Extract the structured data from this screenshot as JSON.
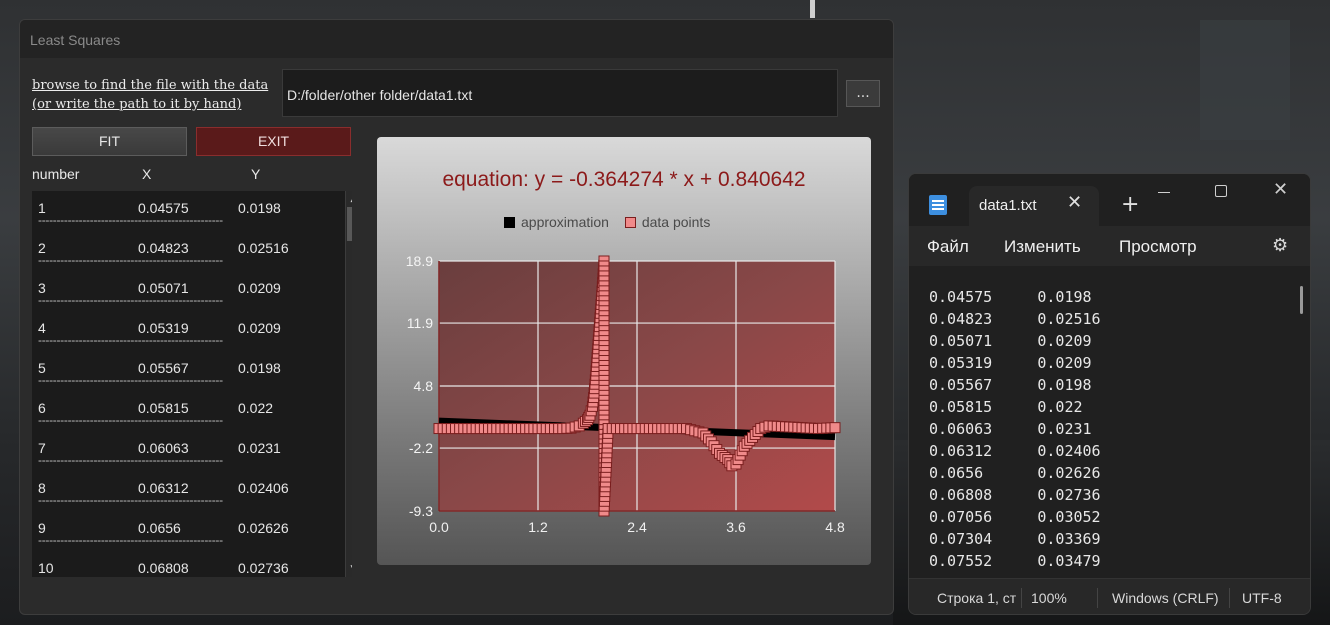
{
  "window": {
    "title": "Least Squares"
  },
  "browse": {
    "label_line1": "browse to find the file with the data",
    "label_line2": "(or write the path to it by hand)",
    "path_value": "D:/folder/other folder/data1.txt",
    "browse_button": "..."
  },
  "buttons": {
    "fit": "FIT",
    "exit": "EXIT"
  },
  "table": {
    "headers": [
      "number",
      "X",
      "Y"
    ],
    "separator": "--------------------------------------------------",
    "rows": [
      [
        "1",
        "0.04575",
        "0.0198"
      ],
      [
        "2",
        "0.04823",
        "0.02516"
      ],
      [
        "3",
        "0.05071",
        "0.0209"
      ],
      [
        "4",
        "0.05319",
        "0.0209"
      ],
      [
        "5",
        "0.05567",
        "0.0198"
      ],
      [
        "6",
        "0.05815",
        "0.022"
      ],
      [
        "7",
        "0.06063",
        "0.0231"
      ],
      [
        "8",
        "0.06312",
        "0.02406"
      ],
      [
        "9",
        "0.0656",
        "0.02626"
      ],
      [
        "10",
        "0.06808",
        "0.02736"
      ]
    ]
  },
  "chart_data": {
    "type": "scatter",
    "title": "equation: y = -0.364274 * x + 0.840642",
    "legend": [
      "approximation",
      "data points"
    ],
    "legend_position": "top",
    "xlim": [
      0.0,
      4.8
    ],
    "ylim": [
      -9.3,
      18.9
    ],
    "xticks": [
      "0.0",
      "1.2",
      "2.4",
      "3.6",
      "4.8"
    ],
    "yticks": [
      "18.9",
      "11.9",
      "4.8",
      "-2.2",
      "-9.3"
    ],
    "grid": true,
    "approximation": {
      "slope": -0.364274,
      "intercept": 0.840642
    },
    "series": [
      {
        "name": "data points",
        "x": [
          0.0,
          0.2,
          0.4,
          0.6,
          0.8,
          1.0,
          1.2,
          1.4,
          1.5,
          1.6,
          1.7,
          1.75,
          1.8,
          1.83,
          1.86,
          1.88,
          1.9,
          1.92,
          1.94,
          1.96,
          1.98,
          2.0,
          2.0,
          2.0,
          2.05,
          2.2,
          2.4,
          2.6,
          2.8,
          3.0,
          3.2,
          3.3,
          3.4,
          3.5,
          3.55,
          3.6,
          3.65,
          3.7,
          3.8,
          3.9,
          4.0,
          4.2,
          4.4,
          4.6,
          4.8
        ],
        "y": [
          0.0,
          0.0,
          0.0,
          0.0,
          0.0,
          0.0,
          0.0,
          0.0,
          0.0,
          0.05,
          0.3,
          0.6,
          1.0,
          1.5,
          2.5,
          4.0,
          6.0,
          8.5,
          11.0,
          13.5,
          16.0,
          18.9,
          1.5,
          -9.3,
          0.0,
          0.0,
          0.0,
          0.0,
          0.0,
          0.0,
          -0.5,
          -1.5,
          -2.8,
          -3.5,
          -4.2,
          -4.0,
          -3.0,
          -2.0,
          -1.0,
          0.0,
          0.3,
          0.2,
          0.1,
          0.0,
          0.1
        ]
      }
    ]
  },
  "notepad": {
    "tab_title": "data1.txt",
    "menu": [
      "Файл",
      "Изменить",
      "Просмотр"
    ],
    "lines": [
      "0.04575     0.0198",
      "0.04823     0.02516",
      "0.05071     0.0209",
      "0.05319     0.0209",
      "0.05567     0.0198",
      "0.05815     0.022",
      "0.06063     0.0231",
      "0.06312     0.02406",
      "0.0656      0.02626",
      "0.06808     0.02736",
      "0.07056     0.03052",
      "0.07304     0.03369",
      "0.07552     0.03479"
    ],
    "status": {
      "position": "Строка 1, ст",
      "zoom": "100%",
      "line_ending": "Windows (CRLF)",
      "encoding": "UTF-8"
    }
  }
}
